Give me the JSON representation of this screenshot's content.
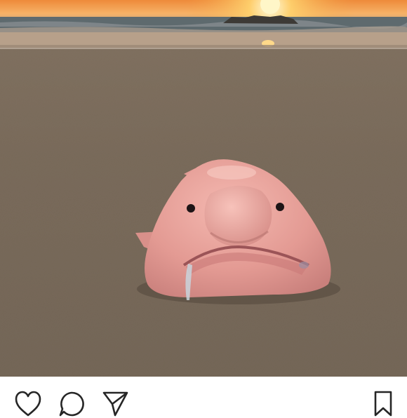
{
  "post": {
    "photo": {
      "subject": "blobfish-on-beach-at-sunset",
      "colors": {
        "sky_top": "#f3a24a",
        "sun": "#fff3b0",
        "sea": "#5d6b70",
        "sand": "#7f6f5f",
        "fish": "#e7a29b",
        "fish_shadow": "#b86a69"
      }
    },
    "actions": {
      "like_icon": "heart-icon",
      "comment_icon": "comment-icon",
      "share_icon": "send-icon",
      "save_icon": "bookmark-icon"
    }
  }
}
